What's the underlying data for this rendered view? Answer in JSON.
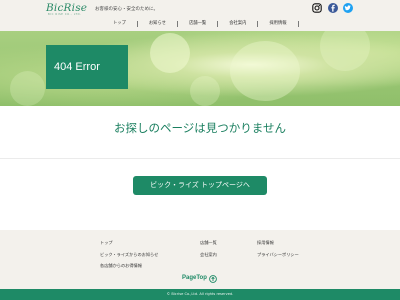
{
  "header": {
    "logo": "BicRise",
    "logo_sub": "BIC RISE CO., LTD.",
    "tagline": "お客様の安心・安全のために。",
    "nav": [
      "トップ",
      "お知らせ",
      "店舗一覧",
      "会社案内",
      "採用情報"
    ],
    "social": [
      "instagram-icon",
      "facebook-icon",
      "twitter-icon"
    ]
  },
  "hero": {
    "title": "404 Error"
  },
  "main": {
    "message": "お探しのページは見つかりません",
    "button_label": "ビック・ライズ トップページへ"
  },
  "footer": {
    "links": [
      "トップ",
      "ビック・ライズからのお知らせ",
      "各店舗からのお得情報",
      "店舗一覧",
      "会社案内",
      "採用情報",
      "プライバシーポリシー"
    ],
    "pagetop": "PageTop",
    "copyright": "© Bicrise Co.,Ltd. All rights reserved."
  },
  "colors": {
    "brand": "#1e8a66",
    "footer_bg": "#f3f1ec"
  }
}
